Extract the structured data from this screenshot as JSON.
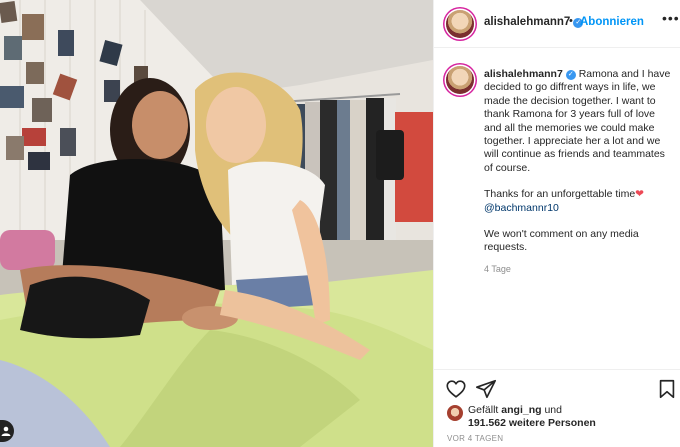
{
  "post": {
    "username": "alishalehmann7",
    "follow_label": "Abonnieren",
    "more_label": "•••",
    "separator": "•",
    "caption_paragraphs": [
      "Ramona and I have decided to go diffrent ways in life, we made the decision together. I want to thank Ramona for 3 years full of love and all the memories we could make together. I appreciate her a lot and we will continue as friends and teammates of course.",
      "Thanks for an unforgettable time",
      "We won't comment on any media requests."
    ],
    "heart_emoji": "❤",
    "mention": "@bachmannr10",
    "time_ago": "4 Tage",
    "likes_prefix": "Gefällt",
    "liked_by": "angi_ng",
    "likes_and": "und",
    "likes_count_text": "191.562 weitere Personen",
    "date_label": "VOR 4 TAGEN"
  },
  "icons": {
    "verified": "verified-badge-icon",
    "like": "heart-outline-icon",
    "share": "paper-plane-icon",
    "save": "bookmark-icon",
    "more": "more-options-icon"
  },
  "colors": {
    "follow_blue": "#0095f6",
    "verified_blue": "#3897f0",
    "heart_red": "#ed4956",
    "muted_gray": "#8e8e8e"
  }
}
